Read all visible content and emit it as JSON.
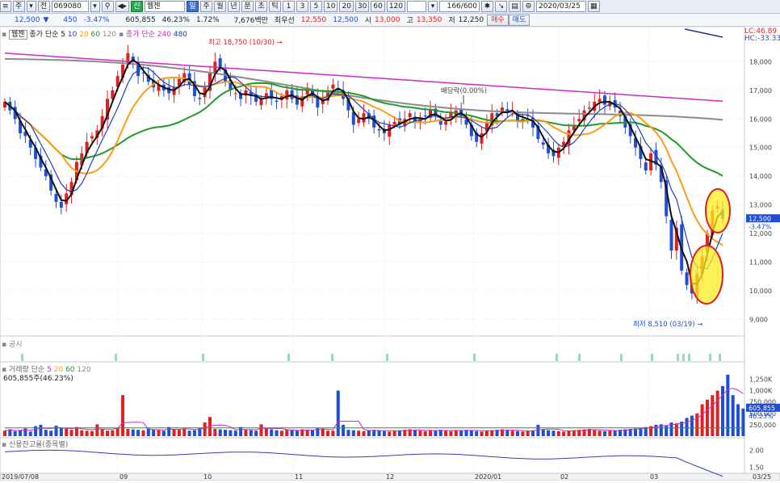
{
  "toolbar": {
    "type_label": "주",
    "jeon_label": "전",
    "code": "069080",
    "market_badge": "신",
    "name": "웹젠",
    "tabs": [
      "일",
      "주",
      "월",
      "년",
      "분",
      "초",
      "틱"
    ],
    "minutes": [
      "1",
      "3",
      "5",
      "10",
      "20",
      "30",
      "60",
      "120"
    ],
    "count": "166/600",
    "date": "2020/03/25"
  },
  "quote": {
    "price": "12,500",
    "change": "450",
    "change_pct": "-3.47%",
    "volume": "605,855",
    "vol_ratio": "46.23%",
    "rate": "1.72%",
    "amount": "7,676백만",
    "best_ask_label": "최우선",
    "best_ask": "12,550",
    "best_bid": "12,500",
    "open_label": "시",
    "open": "13,000",
    "high_label": "고",
    "high": "13,350",
    "low_label": "저",
    "low": "12,250",
    "buy_label": "매수",
    "sell_label": "매도"
  },
  "legend": {
    "name": "웹젠",
    "ma_label": "종가 단순",
    "ma_periods": [
      "5",
      "10",
      "20",
      "60",
      "120"
    ],
    "ma_long_label": "종가 단순",
    "ma_long_periods": [
      "240",
      "480"
    ],
    "lc": "LC:46.89",
    "hc": "HC:-33.33"
  },
  "annotations": {
    "high": "최고 18,750 (10/30)",
    "low": "최저 8,510 (03/19)",
    "dividend": "배당락(0.00%)",
    "current_price": "12,500",
    "current_pct": "-3.47%"
  },
  "panels": {
    "notice": "공시",
    "volume": "거래량",
    "volume_ma": "단순",
    "volume_ma_periods": [
      "5",
      "20",
      "60",
      "120"
    ],
    "volume_text": "605,855주(46.23%)",
    "volume_box": "605,855",
    "volume_pct": "46.23%",
    "credit": "신용잔고율(종목별)"
  },
  "x_axis": [
    "2019/07/08",
    "09",
    "10",
    "11",
    "12",
    "2020/01",
    "02",
    "03",
    "03/25"
  ],
  "colors": {
    "up": "#e02020",
    "down": "#1f4fd1",
    "ma5": "#111111",
    "ma10": "#1f3fbf",
    "ma20": "#ff9b14",
    "ma60": "#1f9b2e",
    "ma120": "#8c8c8c",
    "ma240": "#d227c9",
    "ma480": "#1c3a9a",
    "highlight": "#ffee22"
  },
  "chart_data": {
    "type": "candlestick",
    "y_ticks": [
      "18,000",
      "17,000",
      "16,000",
      "15,000",
      "14,000",
      "13,000",
      "12,000",
      "11,000",
      "10,000",
      "9,000"
    ],
    "volume_ticks": [
      "1,250K",
      "1,000K",
      "750,000",
      "500,000",
      "250,000"
    ],
    "credit_ticks": [
      "2.00",
      "1.50"
    ],
    "closes": [
      16600,
      16300,
      16000,
      15500,
      15400,
      15000,
      14600,
      14300,
      14000,
      13500,
      13100,
      12900,
      13400,
      13800,
      14500,
      14800,
      15200,
      15400,
      15600,
      16100,
      16700,
      17000,
      17500,
      17900,
      18300,
      18000,
      17500,
      17600,
      17300,
      17100,
      17200,
      17000,
      16900,
      17100,
      17400,
      17600,
      17200,
      16800,
      16700,
      17100,
      17600,
      18000,
      17800,
      17300,
      17000,
      16900,
      16700,
      17000,
      16800,
      16600,
      16700,
      16900,
      16700,
      16600,
      16800,
      17000,
      16700,
      16500,
      16800,
      17100,
      16800,
      16400,
      16700,
      17000,
      17200,
      17000,
      16700,
      16300,
      15800,
      16000,
      16200,
      16000,
      15700,
      15600,
      15500,
      15800,
      15900,
      15800,
      16000,
      16200,
      15900,
      16000,
      16100,
      16300,
      16100,
      15800,
      15900,
      16200,
      16300,
      16100,
      15800,
      15400,
      15200,
      15500,
      15900,
      16200,
      16100,
      16400,
      16200,
      16300,
      15900,
      16000,
      16100,
      15700,
      15300,
      15100,
      14800,
      14700,
      15000,
      15200,
      15600,
      15800,
      16000,
      16300,
      16400,
      16600,
      16700,
      16500,
      16600,
      16400,
      16100,
      15700,
      15400,
      15000,
      14600,
      14200,
      14800,
      14400,
      13800,
      12600,
      11400,
      12200,
      10700,
      10200,
      9900,
      10600,
      11200,
      12000,
      12800,
      12950,
      12500
    ],
    "volume": [
      120,
      150,
      110,
      130,
      170,
      100,
      220,
      250,
      140,
      120,
      230,
      180,
      160,
      140,
      200,
      130,
      120,
      110,
      260,
      150,
      120,
      130,
      180,
      900,
      160,
      150,
      140,
      130,
      170,
      140,
      130,
      120,
      200,
      160,
      140,
      170,
      120,
      130,
      180,
      300,
      420,
      160,
      150,
      140,
      130,
      120,
      200,
      140,
      130,
      120,
      260,
      180,
      150,
      130,
      120,
      140,
      130,
      120,
      150,
      140,
      130,
      180,
      170,
      120,
      120,
      1000,
      250,
      140,
      130,
      120,
      110,
      130,
      140,
      120,
      110,
      100,
      120,
      130,
      140,
      150,
      130,
      120,
      110,
      120,
      130,
      140,
      120,
      110,
      130,
      120,
      140,
      130,
      110,
      100,
      120,
      130,
      140,
      150,
      130,
      120,
      110,
      100,
      120,
      130,
      250,
      140,
      130,
      120,
      110,
      100,
      120,
      130,
      140,
      150,
      160,
      130,
      120,
      110,
      120,
      130,
      140,
      150,
      160,
      170,
      180,
      200,
      220,
      250,
      260,
      230,
      300,
      280,
      320,
      400,
      450,
      500,
      700,
      800,
      900,
      1000,
      1100,
      1350,
      900,
      700,
      606
    ]
  }
}
